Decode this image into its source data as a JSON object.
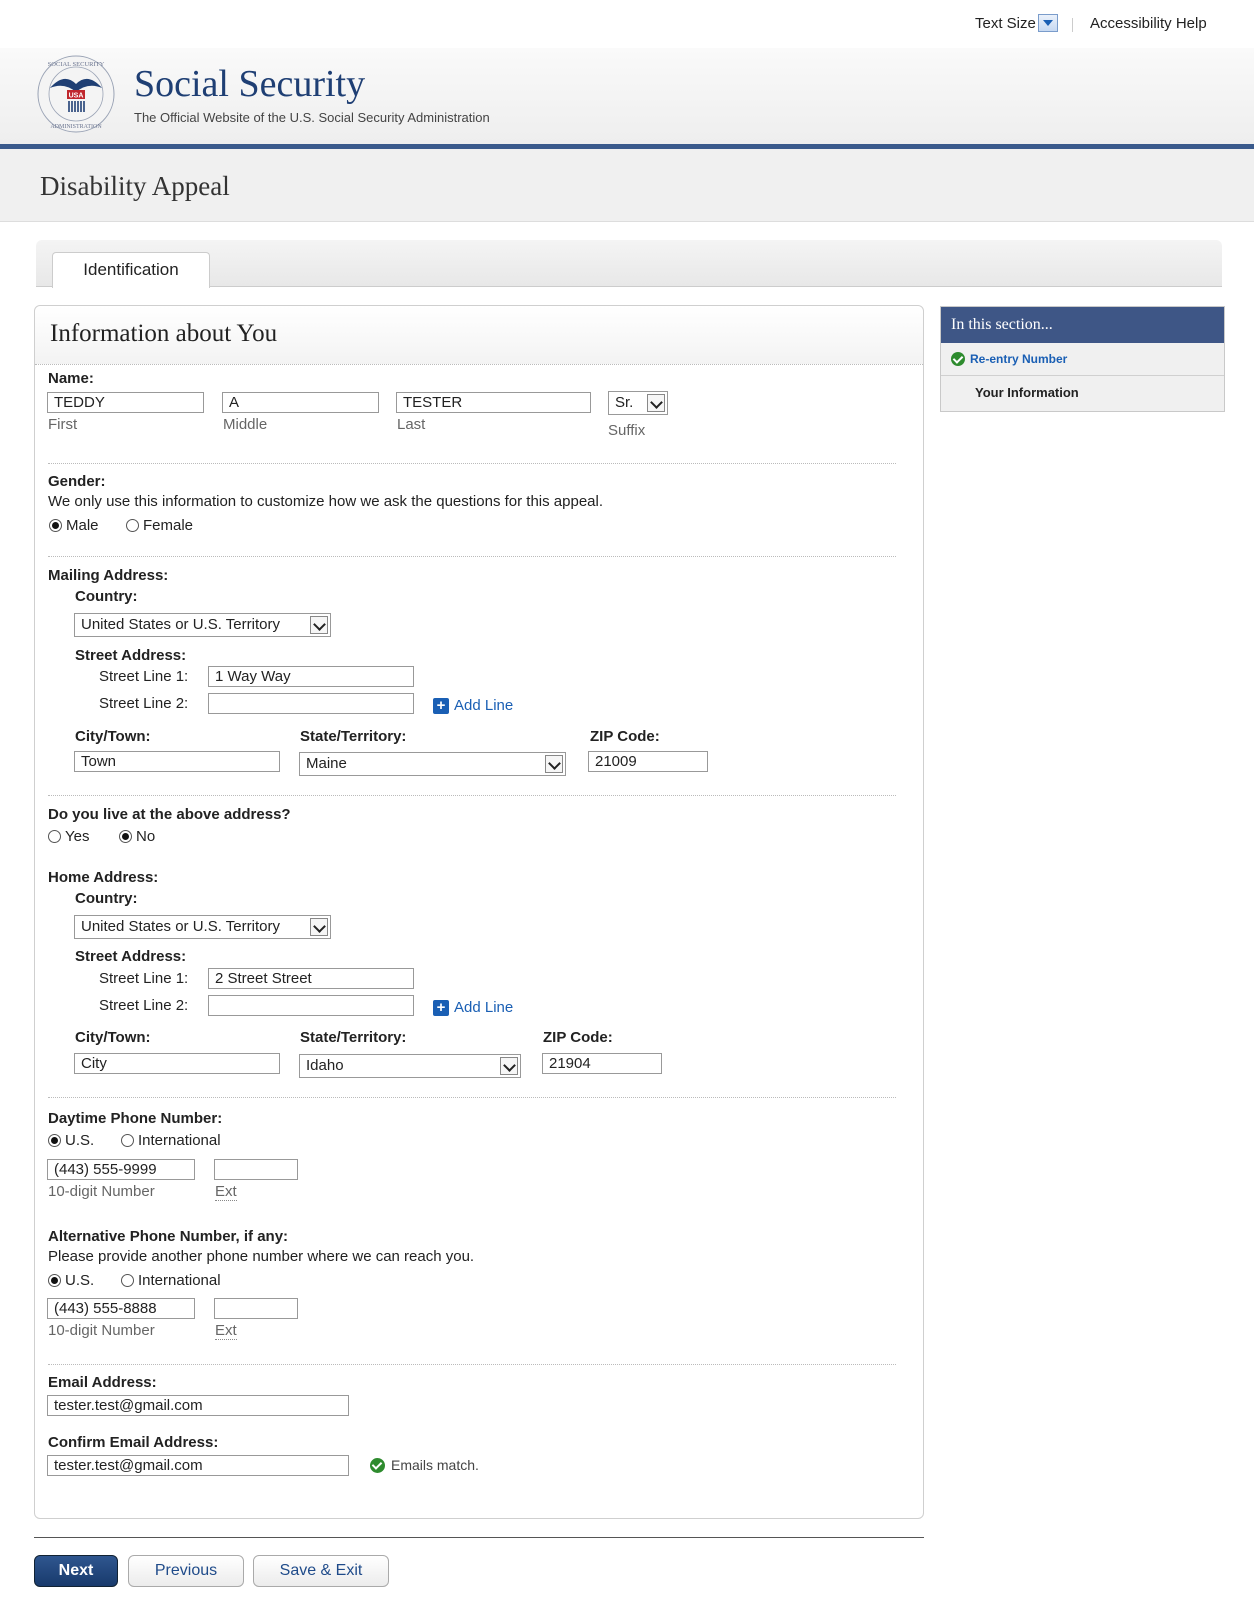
{
  "utility": {
    "text_size": "Text Size",
    "accessibility_help": "Accessibility Help"
  },
  "header": {
    "brand": "Social Security",
    "tagline": "The Official Website of the U.S. Social Security Administration",
    "seal_text_top": "SOCIAL SECURITY",
    "seal_text_bottom": "ADMINISTRATION",
    "seal_usa": "USA"
  },
  "page_title": "Disability Appeal",
  "tabs": [
    {
      "label": "Identification"
    }
  ],
  "panel": {
    "title": "Information about You",
    "name": {
      "label": "Name:",
      "first": "TEDDY",
      "first_caption": "First",
      "middle": "A",
      "middle_caption": "Middle",
      "last": "TESTER",
      "last_caption": "Last",
      "suffix": "Sr.",
      "suffix_caption": "Suffix"
    },
    "gender": {
      "label": "Gender:",
      "note": "We only use this information to customize how we ask the questions for this appeal.",
      "options": [
        "Male",
        "Female"
      ],
      "selected": "Male"
    },
    "mailing": {
      "label": "Mailing Address:",
      "country_label": "Country:",
      "country": "United States or U.S. Territory",
      "street_label": "Street Address:",
      "line1_label": "Street Line 1:",
      "line1": "1 Way Way",
      "line2_label": "Street Line 2:",
      "line2": "",
      "add_line": "Add Line",
      "city_label": "City/Town:",
      "city": "Town",
      "state_label": "State/Territory:",
      "state": "Maine",
      "zip_label": "ZIP Code:",
      "zip": "21009"
    },
    "live_at_above": {
      "label": "Do you live at the above address?",
      "options": [
        "Yes",
        "No"
      ],
      "selected": "No"
    },
    "home": {
      "label": "Home Address:",
      "country_label": "Country:",
      "country": "United States or U.S. Territory",
      "street_label": "Street Address:",
      "line1_label": "Street Line 1:",
      "line1": "2 Street Street",
      "line2_label": "Street Line 2:",
      "line2": "",
      "add_line": "Add Line",
      "city_label": "City/Town:",
      "city": "City",
      "state_label": "State/Territory:",
      "state": "Idaho",
      "zip_label": "ZIP Code:",
      "zip": "21904"
    },
    "daytime_phone": {
      "label": "Daytime Phone Number:",
      "options": [
        "U.S.",
        "International"
      ],
      "selected": "U.S.",
      "number": "(443) 555-9999",
      "number_caption": "10-digit Number",
      "ext": "",
      "ext_caption": "Ext"
    },
    "alt_phone": {
      "label": "Alternative Phone Number, if any:",
      "note": "Please provide another phone number where we can reach you.",
      "options": [
        "U.S.",
        "International"
      ],
      "selected": "U.S.",
      "number": "(443) 555-8888",
      "number_caption": "10-digit Number",
      "ext": "",
      "ext_caption": "Ext"
    },
    "email": {
      "label": "Email Address:",
      "value": "tester.test@gmail.com"
    },
    "confirm_email": {
      "label": "Confirm Email Address:",
      "value": "tester.test@gmail.com",
      "status": "Emails match."
    }
  },
  "sidebar": {
    "title": "In this section...",
    "items": [
      {
        "label": "Re-entry Number",
        "status": "complete"
      },
      {
        "label": "Your Information",
        "status": "current"
      }
    ]
  },
  "buttons": {
    "next": "Next",
    "previous": "Previous",
    "save_exit": "Save & Exit"
  },
  "colors": {
    "brand_navy": "#1f3f74",
    "accent_blue": "#1a5fb4",
    "sidebar_header": "#3e5686",
    "success_green": "#2e8b2e"
  }
}
